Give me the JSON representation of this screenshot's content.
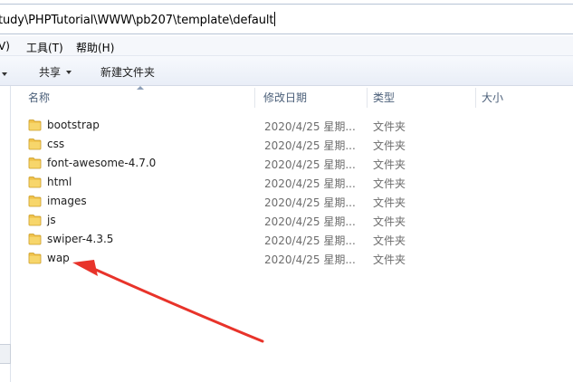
{
  "address_bar": {
    "path": "tudy\\PHPTutorial\\WWW\\pb207\\template\\default"
  },
  "menu": [
    "V)",
    "工具(T)",
    "帮助(H)"
  ],
  "toolbar": {
    "share_label": "共享",
    "new_folder_label": "新建文件夹"
  },
  "columns": {
    "name": "名称",
    "date": "修改日期",
    "type": "类型",
    "size": "大小"
  },
  "files": [
    {
      "name": "bootstrap",
      "date": "2020/4/25 星期...",
      "type": "文件夹"
    },
    {
      "name": "css",
      "date": "2020/4/25 星期...",
      "type": "文件夹"
    },
    {
      "name": "font-awesome-4.7.0",
      "date": "2020/4/25 星期...",
      "type": "文件夹"
    },
    {
      "name": "html",
      "date": "2020/4/25 星期...",
      "type": "文件夹"
    },
    {
      "name": "images",
      "date": "2020/4/25 星期...",
      "type": "文件夹"
    },
    {
      "name": "js",
      "date": "2020/4/25 星期...",
      "type": "文件夹"
    },
    {
      "name": "swiper-4.3.5",
      "date": "2020/4/25 星期...",
      "type": "文件夹"
    },
    {
      "name": "wap",
      "date": "2020/4/25 星期...",
      "type": "文件夹"
    }
  ],
  "icons": {
    "folder": "folder-icon",
    "annotation": "red-arrow-annotation"
  },
  "colors": {
    "folder": "#f0c14a",
    "annotation": "#e8332a",
    "header_text": "#4c607a"
  }
}
